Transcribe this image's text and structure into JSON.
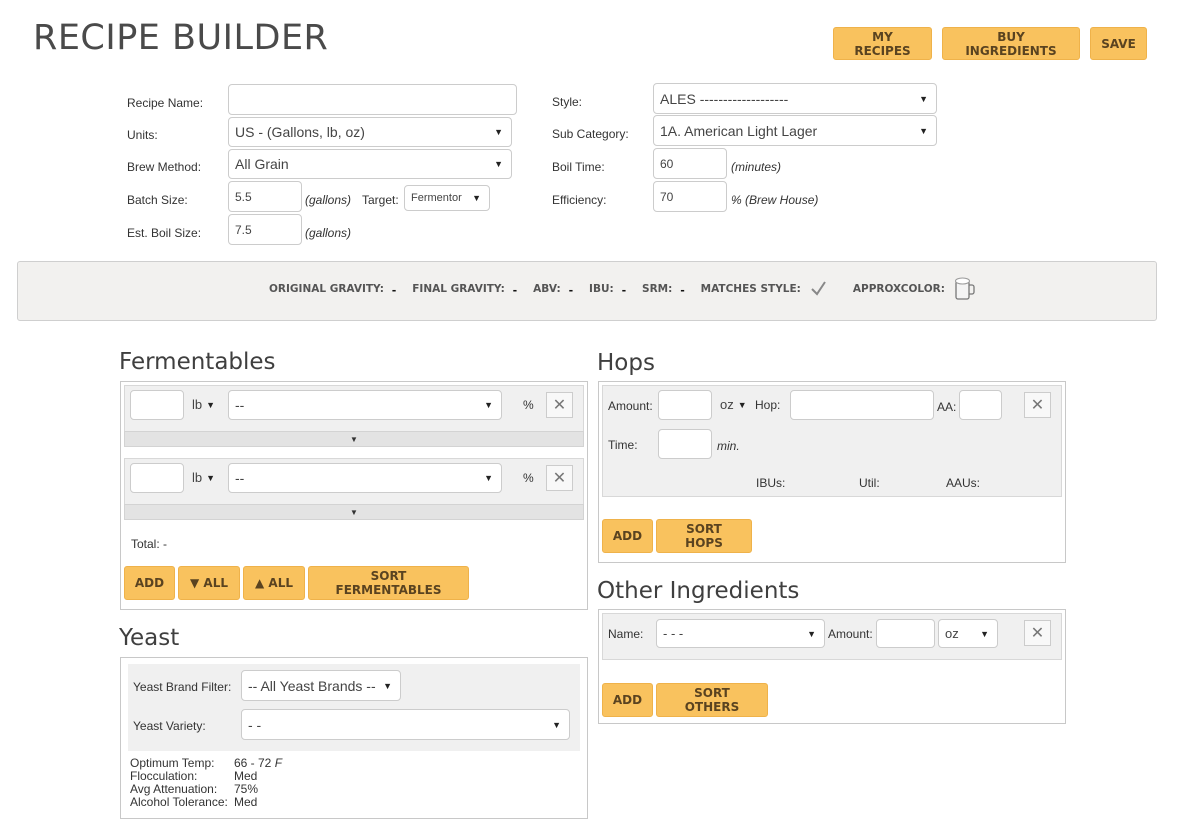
{
  "header": {
    "title": "RECIPE BUILDER",
    "buttons": {
      "my_recipes": "MY RECIPES",
      "buy_ingredients": "BUY INGREDIENTS",
      "save": "SAVE"
    }
  },
  "form": {
    "recipe_name": {
      "label": "Recipe Name:",
      "value": ""
    },
    "units": {
      "label": "Units:",
      "value": "US - (Gallons, lb, oz)"
    },
    "brew_method": {
      "label": "Brew Method:",
      "value": "All Grain"
    },
    "batch_size": {
      "label": "Batch Size:",
      "value": "5.5",
      "unit": "(gallons)"
    },
    "target": {
      "label": "Target:",
      "value": "Fermentor"
    },
    "boil_size": {
      "label": "Est. Boil Size:",
      "value": "7.5",
      "unit": "(gallons)"
    },
    "style": {
      "label": "Style:",
      "value": "ALES -------------------"
    },
    "sub_category": {
      "label": "Sub Category:",
      "value": "1A. American Light Lager"
    },
    "boil_time": {
      "label": "Boil Time:",
      "value": "60",
      "unit": "(minutes)"
    },
    "efficiency": {
      "label": "Efficiency:",
      "value": "70",
      "unit": "% (Brew House)"
    }
  },
  "summary": {
    "og": "ORIGINAL GRAVITY:",
    "fg": "FINAL GRAVITY:",
    "abv": "ABV:",
    "ibu": "IBU:",
    "srm": "SRM:",
    "matches": "MATCHES STYLE:",
    "color": "APPROXCOLOR:",
    "dash": "-"
  },
  "fermentables": {
    "title": "Fermentables",
    "rows": [
      {
        "amount": "",
        "unit": "lb",
        "grain": "--",
        "pct": "%"
      },
      {
        "amount": "",
        "unit": "lb",
        "grain": "--",
        "pct": "%"
      }
    ],
    "total": "Total: -",
    "buttons": {
      "add": "ADD",
      "down_all": "▼ ALL",
      "up_all": "▲ ALL",
      "sort": "SORT FERMENTABLES"
    }
  },
  "yeast": {
    "title": "Yeast",
    "brand_label": "Yeast Brand Filter:",
    "brand_value": "-- All Yeast Brands --",
    "variety_label": "Yeast Variety:",
    "variety_value": "- -",
    "info": [
      {
        "k": "Optimum Temp:",
        "v": "66 - 72",
        "unit": "F"
      },
      {
        "k": "Flocculation:",
        "v": "Med",
        "unit": ""
      },
      {
        "k": "Avg Attenuation:",
        "v": "75%",
        "unit": ""
      },
      {
        "k": "Alcohol Tolerance:",
        "v": "Med",
        "unit": ""
      }
    ]
  },
  "hops": {
    "title": "Hops",
    "amount_label": "Amount:",
    "unit": "oz",
    "hop_label": "Hop:",
    "aa_label": "AA:",
    "time_label": "Time:",
    "time_unit": "min.",
    "ibus": "IBUs:",
    "util": "Util:",
    "aaus": "AAUs:",
    "buttons": {
      "add": "ADD",
      "sort": "SORT HOPS"
    }
  },
  "other": {
    "title": "Other Ingredients",
    "name_label": "Name:",
    "name_value": "- - -",
    "amount_label": "Amount:",
    "unit": "oz",
    "buttons": {
      "add": "ADD",
      "sort": "SORT OTHERS"
    }
  },
  "colors": {
    "accent": "#f9c25e",
    "summary_bg": "#f2f1ef"
  },
  "icons": {
    "remove": "close-icon",
    "check": "checkmark-icon",
    "mug": "beer-mug-icon"
  }
}
